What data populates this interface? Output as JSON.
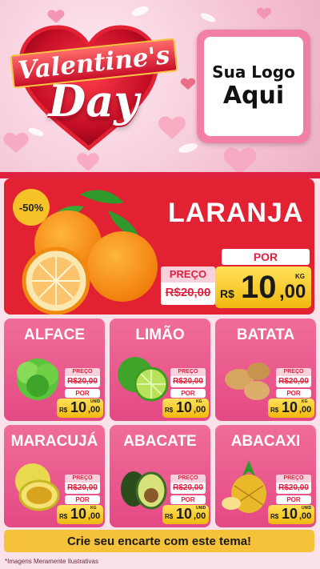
{
  "header": {
    "title_line1": "Valentine's",
    "title_line2": "Day",
    "logo_line1": "Sua Logo",
    "logo_line2": "Aqui"
  },
  "hero": {
    "discount": "-50%",
    "name": "LARANJA",
    "preco_label": "PREÇO",
    "old_price": "R$20,00",
    "por_label": "POR",
    "currency": "R$",
    "price_int": "10",
    "price_dec": ",00",
    "unit": "KG"
  },
  "products": [
    {
      "name": "ALFACE",
      "preco_label": "PREÇO",
      "old_price": "R$20,00",
      "por_label": "POR",
      "currency": "R$",
      "price_int": "10",
      "price_dec": ",00",
      "unit": "UNID"
    },
    {
      "name": "LIMÃO",
      "preco_label": "PREÇO",
      "old_price": "R$20,00",
      "por_label": "POR",
      "currency": "R$",
      "price_int": "10",
      "price_dec": ",00",
      "unit": "KG"
    },
    {
      "name": "BATATA",
      "preco_label": "PREÇO",
      "old_price": "R$20,00",
      "por_label": "POR",
      "currency": "R$",
      "price_int": "10",
      "price_dec": ",00",
      "unit": "KG"
    },
    {
      "name": "MARACUJÁ",
      "preco_label": "PREÇO",
      "old_price": "R$20,00",
      "por_label": "POR",
      "currency": "R$",
      "price_int": "10",
      "price_dec": ",00",
      "unit": "KG"
    },
    {
      "name": "ABACATE",
      "preco_label": "PREÇO",
      "old_price": "R$20,00",
      "por_label": "POR",
      "currency": "R$",
      "price_int": "10",
      "price_dec": ",00",
      "unit": "UNID"
    },
    {
      "name": "ABACAXI",
      "preco_label": "PREÇO",
      "old_price": "R$20,00",
      "por_label": "POR",
      "currency": "R$",
      "price_int": "10",
      "price_dec": ",00",
      "unit": "UNID"
    }
  ],
  "footer": {
    "cta": "Crie seu encarte com este tema!",
    "note": "*Imagens Meramente Ilustrativas"
  },
  "colors": {
    "red": "#e22133",
    "pink_card": "#e44984",
    "gold": "#f6c23a"
  }
}
